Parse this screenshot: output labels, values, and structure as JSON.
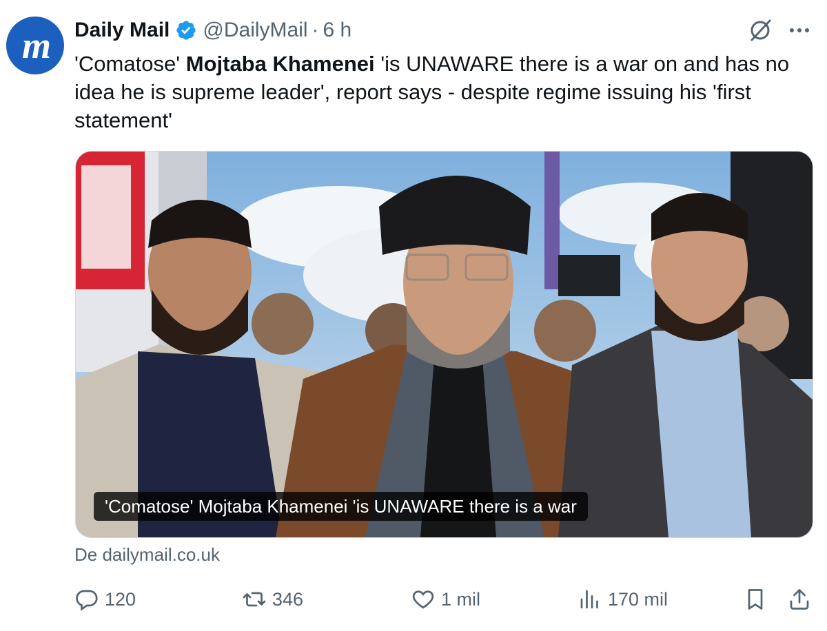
{
  "account": {
    "avatar_letters": "m",
    "name": "Daily Mail",
    "handle": "@DailyMail",
    "separator": "·",
    "time": "6 h"
  },
  "post": {
    "text_before": "'Comatose' ",
    "text_bold": "Mojtaba Khamenei",
    "text_after": " 'is UNAWARE there is a war on and has no idea he is supreme leader', report says - despite regime issuing his 'first statement'"
  },
  "media": {
    "caption": "'Comatose' Mojtaba Khamenei 'is UNAWARE there is a war",
    "source": "De dailymail.co.uk"
  },
  "actions": {
    "replies": "120",
    "reposts": "346",
    "likes": "1 mil",
    "views": "170 mil"
  },
  "colors": {
    "avatar_bg": "#1d5fbf",
    "verified": "#1d9bf0",
    "secondary_text": "#536471"
  },
  "icons": [
    "verified-badge-icon",
    "grok-icon",
    "more-icon",
    "reply-icon",
    "repost-icon",
    "like-icon",
    "views-icon",
    "bookmark-icon",
    "share-icon"
  ]
}
